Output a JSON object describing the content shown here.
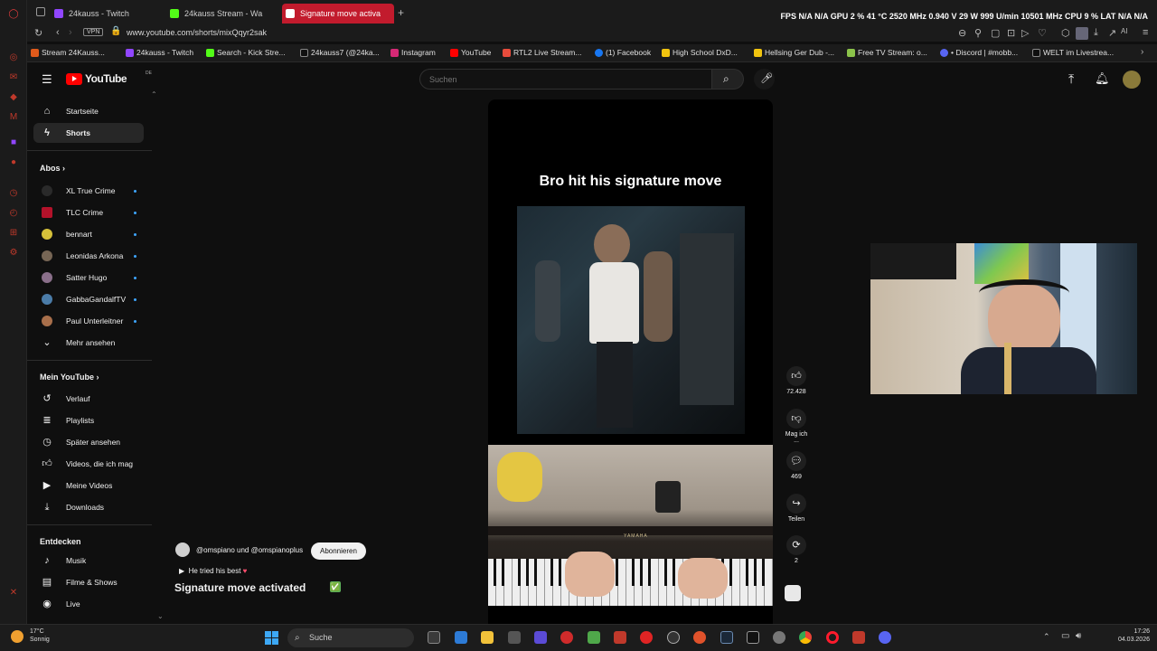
{
  "browser": {
    "tabs": [
      {
        "label": "24kauss - Twitch",
        "active": false
      },
      {
        "label": "24kauss Stream - Wa",
        "active": false
      },
      {
        "label": "Signature move activa",
        "active": true
      }
    ],
    "stats": "FPS  N/A  N/A    GPU  2 %  41 °C  2520 MHz  0.940 V  29 W  999 U/min  10501 MHz    CPU  9 %    LAT  N/A  N/A",
    "vpn": "VPN",
    "url": "www.youtube.com/shorts/mixQqyr2sak",
    "bookmarks": [
      "Stream 24Kauss...",
      "24kauss - Twitch",
      "Search - Kick Stre...",
      "24kauss7 (@24ka...",
      "Instagram",
      "YouTube",
      "RTL2 Live Stream...",
      "(1) Facebook",
      "High School DxD...",
      "Hellsing Ger Dub -...",
      "Free TV Stream: o...",
      "• Discord | #mobb...",
      "WELT im Livestrea..."
    ]
  },
  "youtube": {
    "logo": "YouTube",
    "logo_region": "DE",
    "search_placeholder": "Suchen",
    "nav": [
      {
        "label": "Startseite",
        "icon": "home-icon"
      },
      {
        "label": "Shorts",
        "icon": "shorts-icon"
      }
    ],
    "subs_heading": "Abos",
    "subscriptions": [
      {
        "label": "XL True Crime",
        "color": "#2a2a2a"
      },
      {
        "label": "TLC Crime",
        "color": "#b3122a"
      },
      {
        "label": "bennart",
        "color": "#d6c13a"
      },
      {
        "label": "Leonidas Arkona",
        "color": "#776655"
      },
      {
        "label": "Satter Hugo",
        "color": "#8a6f8a"
      },
      {
        "label": "GabbaGandalfTV",
        "color": "#4b7ca8"
      },
      {
        "label": "Paul Unterleitner",
        "color": "#a86f4b"
      }
    ],
    "more": "Mehr ansehen",
    "you_heading": "Mein YouTube",
    "you_items": [
      {
        "label": "Verlauf",
        "icon": "history-icon"
      },
      {
        "label": "Playlists",
        "icon": "playlists-icon"
      },
      {
        "label": "Später ansehen",
        "icon": "watch-later-icon"
      },
      {
        "label": "Videos, die ich mag",
        "icon": "liked-videos-icon"
      },
      {
        "label": "Meine Videos",
        "icon": "my-videos-icon"
      },
      {
        "label": "Downloads",
        "icon": "downloads-icon"
      }
    ],
    "explore_heading": "Entdecken",
    "explore_items": [
      {
        "label": "Musik",
        "icon": "music-icon"
      },
      {
        "label": "Filme & Shows",
        "icon": "movies-icon"
      },
      {
        "label": "Live",
        "icon": "live-icon"
      }
    ]
  },
  "short": {
    "overlay_title": "Bro hit his signature move",
    "piano_brand": "YAMAHA",
    "likes": "72.428",
    "dislike_label": "Mag ich ...",
    "comments": "469",
    "share_label": "Teilen",
    "remix_count": "2",
    "channels": "@omspiano und @omspianoplus",
    "subscribe_label": "Abonnieren",
    "song": "He tried his best",
    "description": "Signature move activated",
    "description_emoji": "✅"
  },
  "taskbar": {
    "temperature": "17°C",
    "weather": "Sonnig",
    "search_label": "Suche",
    "time": "17:26",
    "date": "04.03.2026"
  },
  "colors": {
    "brand_red": "#ff0000",
    "opera_red": "#c21b2d",
    "dot_blue": "#3ea6ff"
  }
}
